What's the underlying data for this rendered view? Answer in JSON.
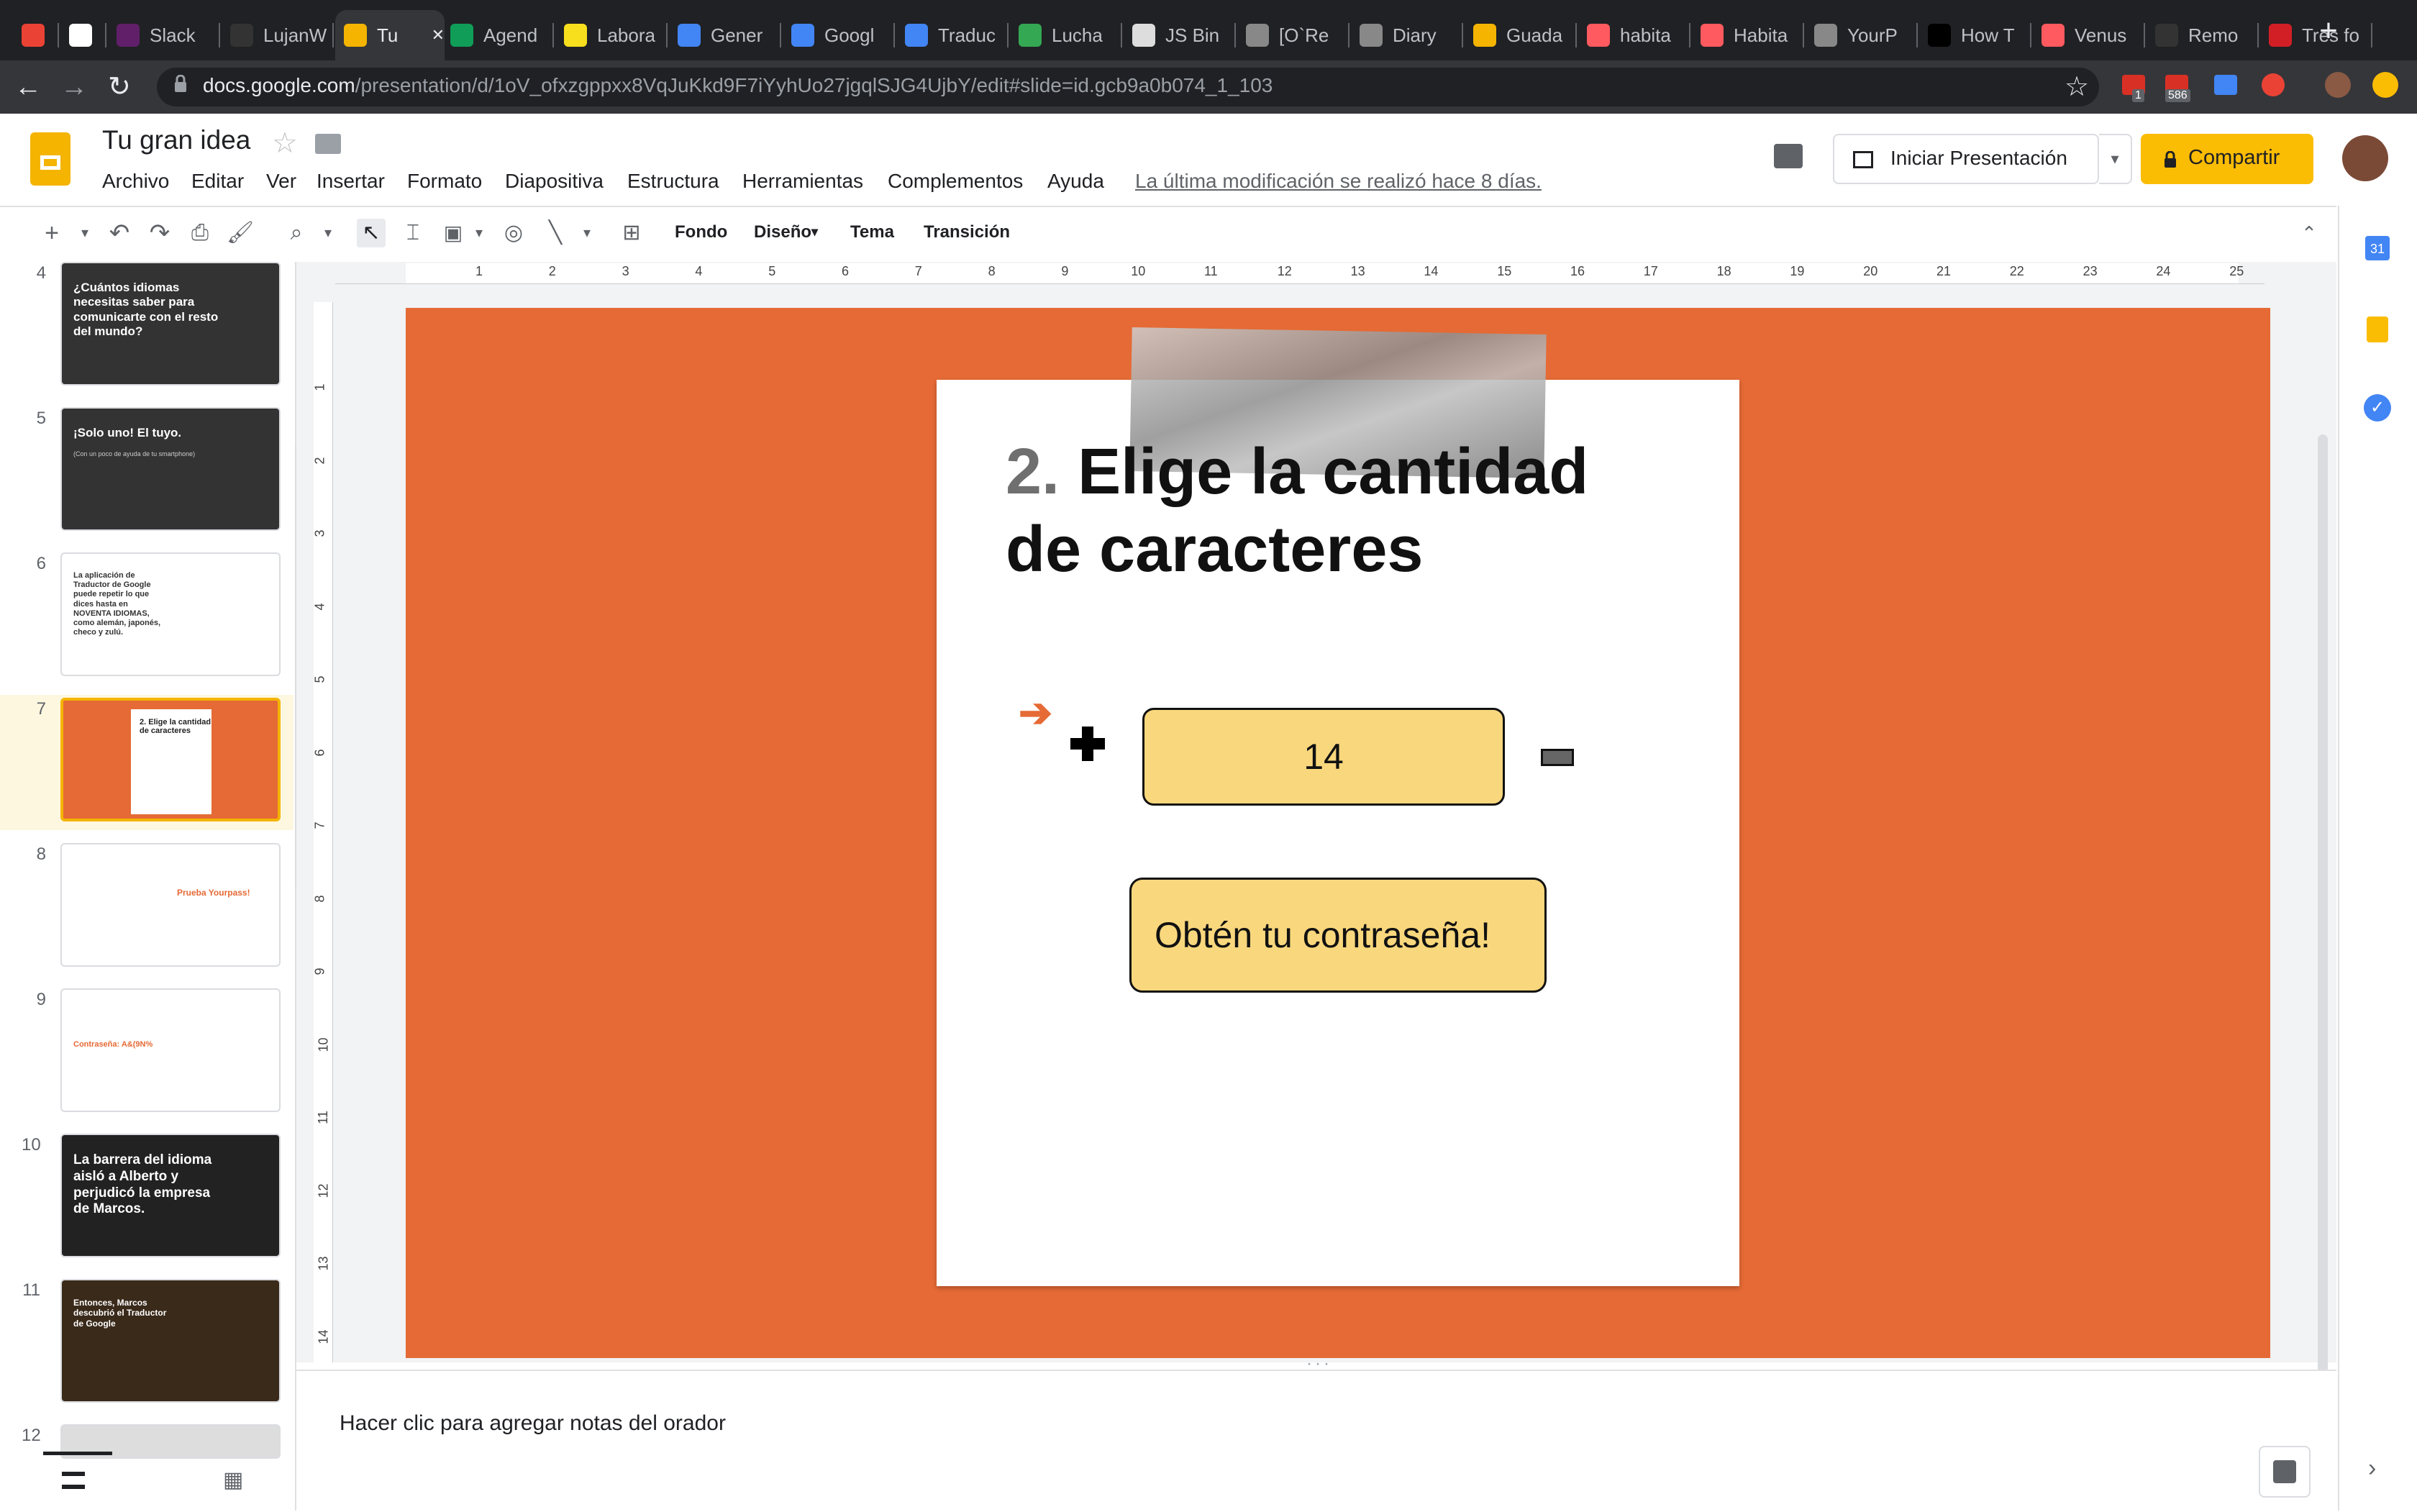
{
  "browser": {
    "tabs": [
      {
        "title": "",
        "icon": "gmail-icon",
        "color": "#ea4335"
      },
      {
        "title": "",
        "icon": "chatgpt-icon",
        "color": "#ffffff"
      },
      {
        "title": "Slack",
        "icon": "slack-icon",
        "color": "#611f69"
      },
      {
        "title": "LujanW",
        "icon": "github-icon",
        "color": "#333333"
      },
      {
        "title": "Tu",
        "icon": "slides-icon",
        "color": "#f4b400",
        "active": true
      },
      {
        "title": "Agend",
        "icon": "sheets-icon",
        "color": "#0f9d58"
      },
      {
        "title": "Labora",
        "icon": "code-icon",
        "color": "#f7df1e"
      },
      {
        "title": "Gener",
        "icon": "chrome-icon",
        "color": "#4285f4"
      },
      {
        "title": "Googl",
        "icon": "calendar-icon",
        "color": "#4285f4"
      },
      {
        "title": "Traduc",
        "icon": "translate-icon",
        "color": "#4285f4"
      },
      {
        "title": "Lucha",
        "icon": "drop-icon",
        "color": "#34a853"
      },
      {
        "title": "JS Bin",
        "icon": "jsbin-icon",
        "color": "#dddddd"
      },
      {
        "title": "[O`Re",
        "icon": "globe-icon",
        "color": "#888888"
      },
      {
        "title": "Diary",
        "icon": "globe-icon",
        "color": "#888888"
      },
      {
        "title": "Guada",
        "icon": "jsfiddle-icon",
        "color": "#f4b400"
      },
      {
        "title": "habita",
        "icon": "airbnb-icon",
        "color": "#ff5a5f"
      },
      {
        "title": "Habita",
        "icon": "airbnb-icon",
        "color": "#ff5a5f"
      },
      {
        "title": "YourP",
        "icon": "globe-icon",
        "color": "#888888"
      },
      {
        "title": "How T",
        "icon": "medium-icon",
        "color": "#000000"
      },
      {
        "title": "Venus",
        "icon": "airbnb-icon",
        "color": "#ff5a5f"
      },
      {
        "title": "Remo",
        "icon": "github-icon",
        "color": "#333333"
      },
      {
        "title": "Tres fo",
        "icon": "cnet-icon",
        "color": "#d21f26"
      }
    ],
    "url_host": "docs.google.com",
    "url_path": "/presentation/d/1oV_ofxzgppxx8VqJuKkd9F7iYyhUo27jgqlSJG4UjbY/edit#slide=id.gcb9a0b074_1_103",
    "ext_badge_1": "1",
    "ext_badge_2": "586"
  },
  "header": {
    "title": "Tu gran idea",
    "menus": [
      "Archivo",
      "Editar",
      "Ver",
      "Insertar",
      "Formato",
      "Diapositiva",
      "Estructura",
      "Herramientas",
      "Complementos",
      "Ayuda"
    ],
    "last_modified": "La última modificación se realizó hace 8 días.",
    "present_label": "Iniciar Presentación",
    "share_label": "Compartir"
  },
  "toolbar": {
    "fondo": "Fondo",
    "diseno": "Diseño",
    "tema": "Tema",
    "transicion": "Transición"
  },
  "filmstrip": {
    "slides": [
      {
        "num": "4",
        "text": "¿Cuántos idiomas necesitas saber para comunicarte con el resto del mundo?",
        "bg": "#333333"
      },
      {
        "num": "5",
        "text": "¡Solo uno! El tuyo.",
        "sub": "(Con un poco de ayuda de tu smartphone)",
        "bg": "#333333"
      },
      {
        "num": "6",
        "text": "La aplicación de Traductor de Google puede repetir lo que dices hasta en NOVENTA IDIOMAS, como alemán, japonés, checo y zulú.",
        "bg": "#ffffff"
      },
      {
        "num": "7",
        "text": "2. Elige la cantidad de caracteres",
        "bg": "#e56a35"
      },
      {
        "num": "8",
        "text": "Prueba Yourpass!",
        "bg": "#ffffff"
      },
      {
        "num": "9",
        "text": "Contraseña: A&(9N%",
        "bg": "#ffffff"
      },
      {
        "num": "10",
        "text": "La barrera del idioma aisló a Alberto y perjudicó la empresa de Marcos.",
        "bg": "#222222"
      },
      {
        "num": "11",
        "text": "Entonces, Marcos descubrió el Traductor de Google",
        "bg": "#3a2a1a"
      },
      {
        "num": "12",
        "text": "",
        "bg": "#dddddd"
      }
    ]
  },
  "ruler": {
    "h": [
      "1",
      "2",
      "3",
      "4",
      "5",
      "6",
      "7",
      "8",
      "9",
      "10",
      "11",
      "12",
      "13",
      "14",
      "15",
      "16",
      "17",
      "18",
      "19",
      "20",
      "21",
      "22",
      "23",
      "24",
      "25"
    ],
    "v": [
      "1",
      "2",
      "3",
      "4",
      "5",
      "6",
      "7",
      "8",
      "9",
      "10",
      "11",
      "12",
      "13",
      "14"
    ]
  },
  "slide": {
    "number_prefix": "2.",
    "heading_line1": "Elige la cantidad",
    "heading_line2": "de caracteres",
    "count_value": "14",
    "cta_label": "Obtén tu contraseña!"
  },
  "notes": {
    "placeholder": "Hacer clic para agregar notas del orador"
  },
  "colors": {
    "slide_bg": "#e56a35",
    "box_fill": "#f9d77d",
    "share_button": "#fbbc04"
  }
}
